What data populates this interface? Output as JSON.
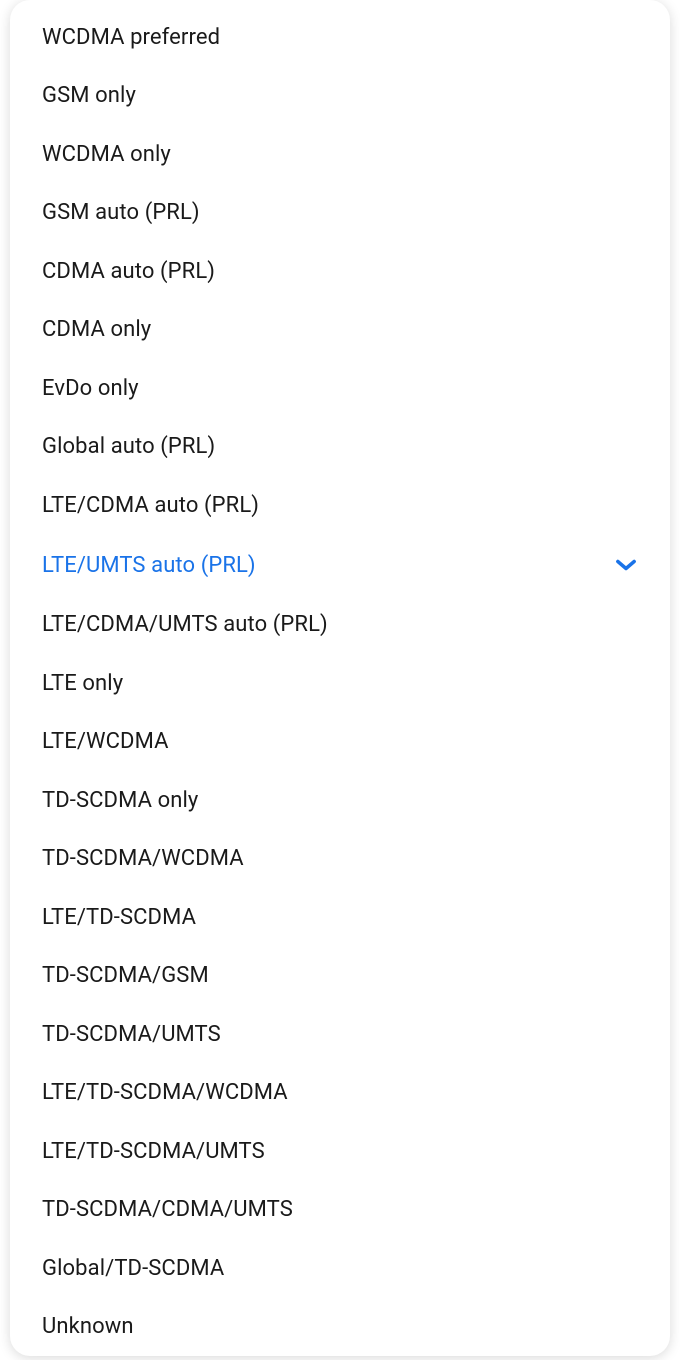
{
  "selectedIndex": 9,
  "accentColor": "#1a73e8",
  "options": [
    {
      "label": "WCDMA preferred"
    },
    {
      "label": "GSM only"
    },
    {
      "label": "WCDMA only"
    },
    {
      "label": "GSM auto (PRL)"
    },
    {
      "label": "CDMA auto (PRL)"
    },
    {
      "label": "CDMA only"
    },
    {
      "label": "EvDo only"
    },
    {
      "label": "Global auto (PRL)"
    },
    {
      "label": "LTE/CDMA auto (PRL)"
    },
    {
      "label": "LTE/UMTS auto (PRL)"
    },
    {
      "label": "LTE/CDMA/UMTS auto (PRL)"
    },
    {
      "label": "LTE only"
    },
    {
      "label": "LTE/WCDMA"
    },
    {
      "label": "TD-SCDMA only"
    },
    {
      "label": "TD-SCDMA/WCDMA"
    },
    {
      "label": "LTE/TD-SCDMA"
    },
    {
      "label": "TD-SCDMA/GSM"
    },
    {
      "label": "TD-SCDMA/UMTS"
    },
    {
      "label": "LTE/TD-SCDMA/WCDMA"
    },
    {
      "label": "LTE/TD-SCDMA/UMTS"
    },
    {
      "label": "TD-SCDMA/CDMA/UMTS"
    },
    {
      "label": "Global/TD-SCDMA"
    },
    {
      "label": "Unknown"
    }
  ]
}
